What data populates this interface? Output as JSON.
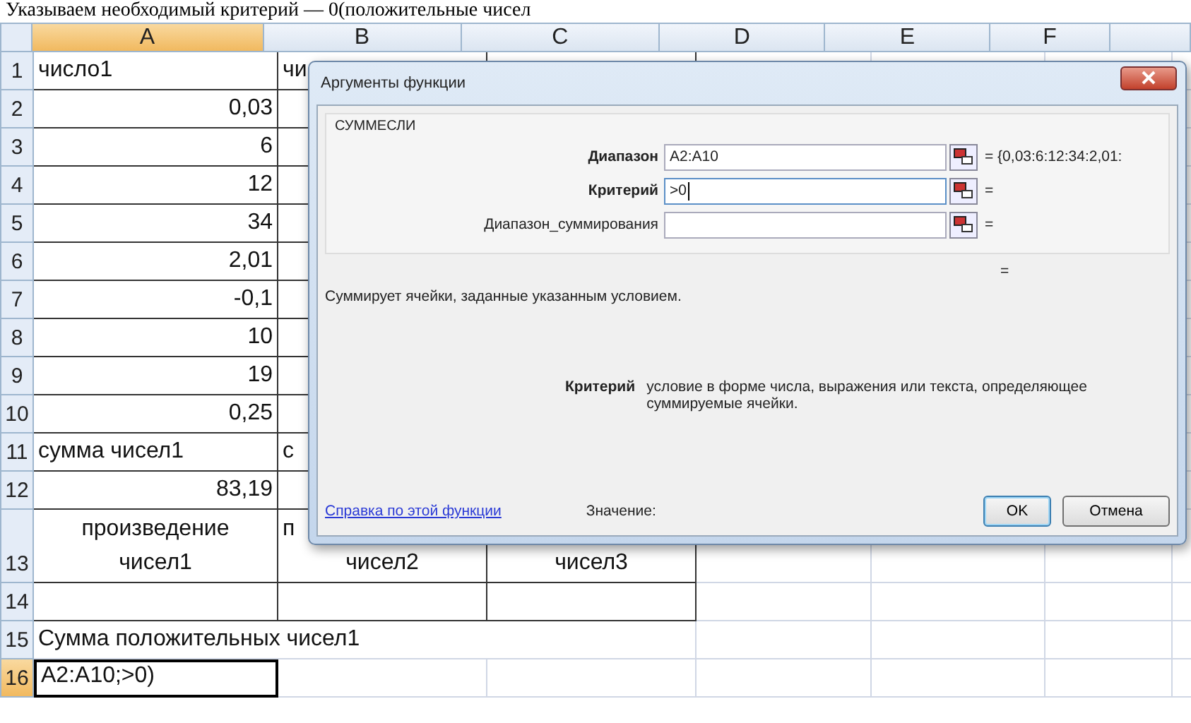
{
  "caption": "Указываем необходимый критерий — 0(положительные чисел",
  "sheet": {
    "columns": [
      {
        "label": "A",
        "selected": true
      },
      {
        "label": "B",
        "selected": false
      },
      {
        "label": "C",
        "selected": false
      },
      {
        "label": "D",
        "selected": false
      },
      {
        "label": "E",
        "selected": false
      },
      {
        "label": "F",
        "selected": false
      }
    ],
    "rows": [
      {
        "number": "1",
        "selected": false,
        "cells": {
          "A": {
            "kind": "text",
            "lines": [
              "число1"
            ]
          },
          "B": {
            "kind": "text",
            "lines": [
              "чи"
            ]
          }
        }
      },
      {
        "number": "2",
        "selected": false,
        "cells": {
          "A": {
            "kind": "number",
            "lines": [
              "0,03"
            ]
          }
        }
      },
      {
        "number": "3",
        "selected": false,
        "cells": {
          "A": {
            "kind": "number",
            "lines": [
              "6"
            ]
          }
        }
      },
      {
        "number": "4",
        "selected": false,
        "cells": {
          "A": {
            "kind": "number",
            "lines": [
              "12"
            ]
          }
        }
      },
      {
        "number": "5",
        "selected": false,
        "cells": {
          "A": {
            "kind": "number",
            "lines": [
              "34"
            ]
          }
        }
      },
      {
        "number": "6",
        "selected": false,
        "cells": {
          "A": {
            "kind": "number",
            "lines": [
              "2,01"
            ]
          }
        }
      },
      {
        "number": "7",
        "selected": false,
        "cells": {
          "A": {
            "kind": "number",
            "lines": [
              "-0,1"
            ]
          }
        }
      },
      {
        "number": "8",
        "selected": false,
        "cells": {
          "A": {
            "kind": "number",
            "lines": [
              "10"
            ]
          }
        }
      },
      {
        "number": "9",
        "selected": false,
        "cells": {
          "A": {
            "kind": "number",
            "lines": [
              "19"
            ]
          }
        }
      },
      {
        "number": "10",
        "selected": false,
        "cells": {
          "A": {
            "kind": "number",
            "lines": [
              "0,25"
            ]
          }
        }
      },
      {
        "number": "11",
        "selected": false,
        "cells": {
          "A": {
            "kind": "text",
            "lines": [
              "сумма чисел1"
            ]
          },
          "B": {
            "kind": "text",
            "lines": [
              "с"
            ]
          }
        }
      },
      {
        "number": "12",
        "selected": false,
        "cells": {
          "A": {
            "kind": "number",
            "lines": [
              "83,19"
            ]
          }
        }
      },
      {
        "number": "13",
        "selected": false,
        "cells": {
          "A": {
            "kind": "centered",
            "lines": [
              "произведение",
              "чисел1"
            ]
          },
          "B": {
            "kind": "covered",
            "lines": [
              "п",
              "чисел2"
            ]
          },
          "C": {
            "kind": "centered",
            "lines": [
              "чисел3"
            ]
          }
        }
      },
      {
        "number": "14",
        "selected": false,
        "cells": {}
      },
      {
        "number": "15",
        "selected": false,
        "cells": {
          "A": {
            "kind": "spill",
            "lines": [
              "Сумма положительных чисел1"
            ]
          }
        }
      },
      {
        "number": "16",
        "selected": true,
        "cells": {
          "A": {
            "kind": "text",
            "editing": true,
            "lines": [
              "A2:A10;>0)"
            ]
          }
        }
      }
    ]
  },
  "dialog": {
    "title": "Аргументы функции",
    "function_name": "СУММЕСЛИ",
    "arguments": [
      {
        "label": "Диапазон",
        "bold": true,
        "value": "A2:A10",
        "focused": false,
        "result": "= {0,03:6:12:34:2,01:"
      },
      {
        "label": "Критерий",
        "bold": true,
        "value": ">0",
        "focused": true,
        "result": "="
      },
      {
        "label": "Диапазон_суммирования",
        "bold": false,
        "focused": false,
        "result": "="
      }
    ],
    "formula_result": "=",
    "description": "Суммирует ячейки, заданные указанным условием.",
    "argument_help": {
      "label": "Критерий",
      "text": "условие в форме числа, выражения или текста, определяющее суммируемые ячейки."
    },
    "help_link": "Справка по этой функции",
    "value_label": "Значение:",
    "buttons": [
      {
        "label": "OK",
        "default": true
      },
      {
        "label": "Отмена",
        "default": false
      }
    ]
  }
}
